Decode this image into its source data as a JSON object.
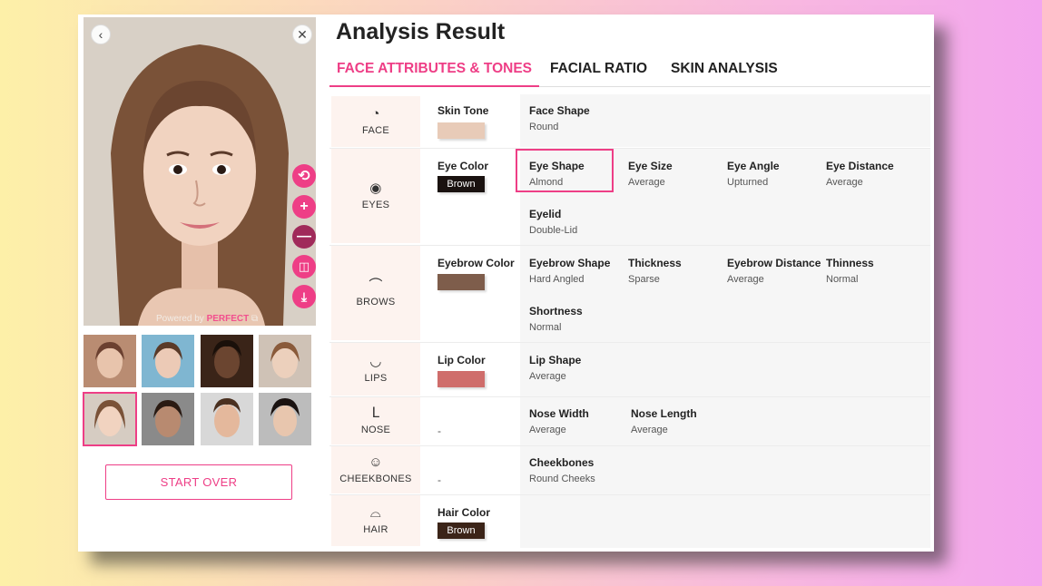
{
  "title": "Analysis Result",
  "tabs": [
    {
      "label": "FACE ATTRIBUTES & TONES",
      "active": true
    },
    {
      "label": "FACIAL RATIO",
      "active": false
    },
    {
      "label": "SKIN ANALYSIS",
      "active": false
    }
  ],
  "photo": {
    "powered_prefix": "Powered by ",
    "powered_brand": "PERFECT",
    "tools": [
      "reset-icon",
      "zoom-in-icon",
      "zoom-out-icon",
      "compare-icon",
      "download-icon"
    ]
  },
  "start_over": "START OVER",
  "categories": {
    "face": {
      "name": "FACE",
      "icon": "face-icon",
      "color": {
        "label": "Skin Tone",
        "hex": "#e8cbb8"
      },
      "attrs": [
        {
          "label": "Face Shape",
          "value": "Round"
        }
      ]
    },
    "eyes": {
      "name": "EYES",
      "icon": "eye-icon",
      "color": {
        "label": "Eye Color",
        "hex": "#1a1210",
        "text": "Brown"
      },
      "attrs": [
        {
          "label": "Eye Shape",
          "value": "Almond",
          "highlighted": true
        },
        {
          "label": "Eye Size",
          "value": "Average"
        },
        {
          "label": "Eye Angle",
          "value": "Upturned"
        },
        {
          "label": "Eye Distance",
          "value": "Average"
        },
        {
          "label": "Eyelid",
          "value": "Double-Lid"
        }
      ]
    },
    "brows": {
      "name": "BROWS",
      "icon": "eyebrow-icon",
      "color": {
        "label": "Eyebrow Color",
        "hex": "#7e5d4b"
      },
      "attrs": [
        {
          "label": "Eyebrow Shape",
          "value": "Hard Angled"
        },
        {
          "label": "Thickness",
          "value": "Sparse"
        },
        {
          "label": "Eyebrow Distance",
          "value": "Average"
        },
        {
          "label": "Thinness",
          "value": "Normal"
        },
        {
          "label": "Shortness",
          "value": "Normal"
        }
      ]
    },
    "lips": {
      "name": "LIPS",
      "icon": "lips-icon",
      "color": {
        "label": "Lip Color",
        "hex": "#cf6d6b"
      },
      "attrs": [
        {
          "label": "Lip Shape",
          "value": "Average"
        }
      ]
    },
    "nose": {
      "name": "NOSE",
      "icon": "nose-icon",
      "color": {
        "dash": "-"
      },
      "attrs": [
        {
          "label": "Nose Width",
          "value": "Average"
        },
        {
          "label": "Nose Length",
          "value": "Average"
        }
      ]
    },
    "cheekbones": {
      "name": "CHEEKBONES",
      "icon": "cheekbones-icon",
      "color": {
        "dash": "-"
      },
      "attrs": [
        {
          "label": "Cheekbones",
          "value": "Round Cheeks"
        }
      ]
    },
    "hair": {
      "name": "HAIR",
      "icon": "hair-icon",
      "color": {
        "label": "Hair Color",
        "hex": "#3b2418",
        "text": "Brown"
      },
      "attrs": []
    }
  }
}
